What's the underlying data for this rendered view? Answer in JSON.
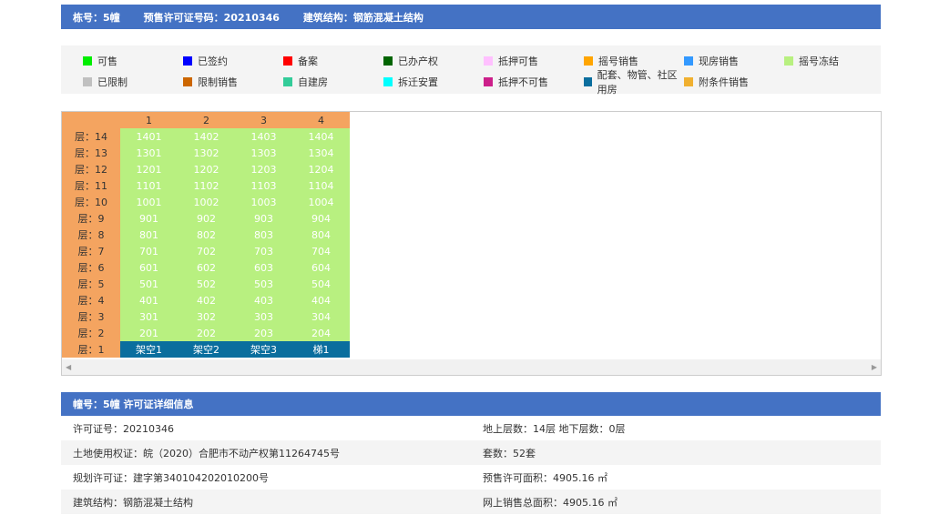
{
  "topbar": {
    "building": "栋号：5幢",
    "permit": "预售许可证号码：20210346",
    "structure": "建筑结构：钢筋混凝土结构"
  },
  "legend": [
    {
      "label": "可售",
      "color": "#00ee00"
    },
    {
      "label": "已签约",
      "color": "#0000ff"
    },
    {
      "label": "备案",
      "color": "#ff0000"
    },
    {
      "label": "已办产权",
      "color": "#006400"
    },
    {
      "label": "抵押可售",
      "color": "#ffc0ff"
    },
    {
      "label": "摇号销售",
      "color": "#ffa500"
    },
    {
      "label": "现房销售",
      "color": "#3399ff"
    },
    {
      "label": "摇号冻结",
      "color": "#b8f080"
    },
    {
      "label": "已限制",
      "color": "#c0c0c0"
    },
    {
      "label": "限制销售",
      "color": "#cc6600"
    },
    {
      "label": "自建房",
      "color": "#33cc99"
    },
    {
      "label": "拆迁安置",
      "color": "#00ffff"
    },
    {
      "label": "抵押不可售",
      "color": "#cc1f8a"
    },
    {
      "label": "配套、物管、社区用房",
      "color": "#0a6e9e"
    },
    {
      "label": "附条件销售",
      "color": "#f0b030"
    }
  ],
  "grid": {
    "columns": [
      "1",
      "2",
      "3",
      "4"
    ],
    "floors": [
      {
        "label": "层：14",
        "units": [
          "1401",
          "1402",
          "1403",
          "1404"
        ]
      },
      {
        "label": "层：13",
        "units": [
          "1301",
          "1302",
          "1303",
          "1304"
        ]
      },
      {
        "label": "层：12",
        "units": [
          "1201",
          "1202",
          "1203",
          "1204"
        ]
      },
      {
        "label": "层：11",
        "units": [
          "1101",
          "1102",
          "1103",
          "1104"
        ]
      },
      {
        "label": "层：10",
        "units": [
          "1001",
          "1002",
          "1003",
          "1004"
        ]
      },
      {
        "label": "层：9",
        "units": [
          "901",
          "902",
          "903",
          "904"
        ]
      },
      {
        "label": "层：8",
        "units": [
          "801",
          "802",
          "803",
          "804"
        ]
      },
      {
        "label": "层：7",
        "units": [
          "701",
          "702",
          "703",
          "704"
        ]
      },
      {
        "label": "层：6",
        "units": [
          "601",
          "602",
          "603",
          "604"
        ]
      },
      {
        "label": "层：5",
        "units": [
          "501",
          "502",
          "503",
          "504"
        ]
      },
      {
        "label": "层：4",
        "units": [
          "401",
          "402",
          "403",
          "404"
        ]
      },
      {
        "label": "层：3",
        "units": [
          "301",
          "302",
          "303",
          "304"
        ]
      },
      {
        "label": "层：2",
        "units": [
          "201",
          "202",
          "203",
          "204"
        ]
      },
      {
        "label": "层：1",
        "units": [
          "架空1",
          "架空2",
          "架空3",
          "梯1"
        ],
        "status": "配套"
      }
    ]
  },
  "detail": {
    "title": "幢号：5幢 许可证详细信息",
    "rows": [
      [
        "许可证号：20210346",
        "地上层数：14层  地下层数：0层"
      ],
      [
        "土地使用权证：皖（2020）合肥市不动产权第11264745号",
        "套数：52套"
      ],
      [
        "规划许可证：建字第340104202010200号",
        "预售许可面积：4905.16 ㎡"
      ],
      [
        "建筑结构：钢筋混凝土结构",
        "网上销售总面积：4905.16 ㎡"
      ]
    ]
  }
}
